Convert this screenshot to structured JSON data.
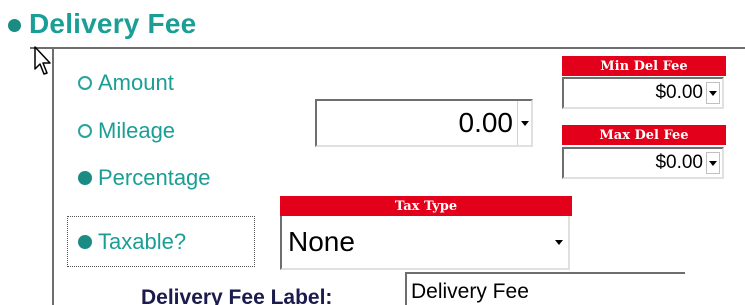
{
  "section": {
    "title": "Delivery Fee"
  },
  "fee_method": {
    "options": [
      {
        "label": "Amount",
        "checked": false
      },
      {
        "label": "Mileage",
        "checked": false
      },
      {
        "label": "Percentage",
        "checked": true
      }
    ]
  },
  "fee_value": {
    "value": "0.00"
  },
  "min_del_fee": {
    "label": "Min Del Fee",
    "value": "$0.00"
  },
  "max_del_fee": {
    "label": "Max Del Fee",
    "value": "$0.00"
  },
  "taxable": {
    "label": "Taxable?",
    "checked": true
  },
  "tax_type": {
    "label": "Tax Type",
    "value": "None"
  },
  "fee_label_field": {
    "label": "Delivery Fee Label:",
    "value": "Delivery Fee"
  },
  "colors": {
    "accent": "#1a9e95",
    "header_red": "#e3001b",
    "label_navy": "#1b1b4d"
  }
}
